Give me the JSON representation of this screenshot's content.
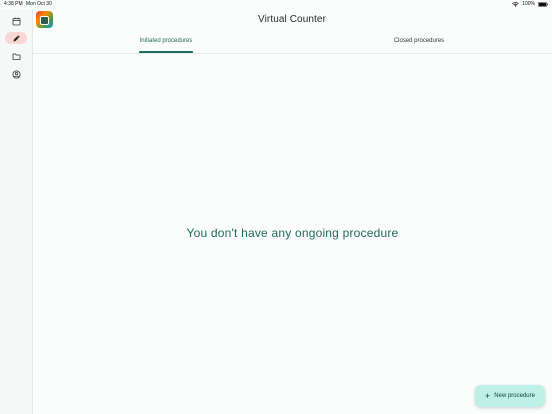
{
  "status_bar": {
    "time": "4:38 PM",
    "date": "Mon Oct 30",
    "battery": "100%",
    "icons": [
      "wifi-icon",
      "battery-icon"
    ]
  },
  "rail": {
    "items": [
      {
        "icon": "calendar-icon",
        "active": false
      },
      {
        "icon": "pencil-icon",
        "active": true
      },
      {
        "icon": "folder-icon",
        "active": false
      },
      {
        "icon": "account-icon",
        "active": false
      }
    ]
  },
  "header": {
    "logo_icon": "app-logo-icon",
    "title": "Virtual Counter"
  },
  "tabs": [
    {
      "label": "Initiated procedures",
      "active": true
    },
    {
      "label": "Closed procedures",
      "active": false
    }
  ],
  "main": {
    "empty_message": "You don't have any ongoing procedure"
  },
  "fab": {
    "icon": "plus-icon",
    "label": "New procedure"
  },
  "colors": {
    "accent": "#1f6b5c",
    "rail_active": "#f7d6d4",
    "fab_bg": "#bff0e6"
  }
}
